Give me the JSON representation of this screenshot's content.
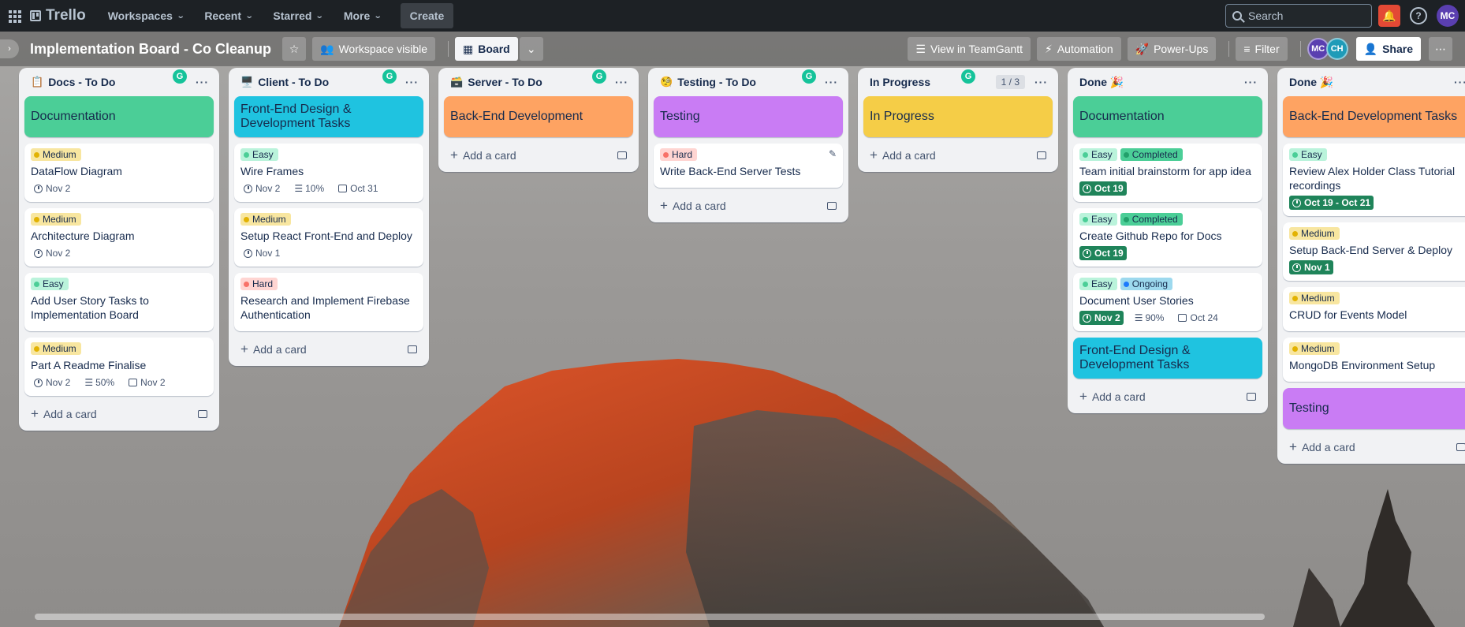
{
  "nav": {
    "logo": "Trello",
    "menus": [
      "Workspaces",
      "Recent",
      "Starred",
      "More"
    ],
    "create": "Create",
    "search_placeholder": "Search",
    "avatar": "MC"
  },
  "board": {
    "title": "Implementation Board - Co Cleanup",
    "visibility": "Workspace visible",
    "view": "Board",
    "buttons": {
      "teamgantt": "View in TeamGantt",
      "automation": "Automation",
      "powerups": "Power-Ups",
      "filter": "Filter",
      "share": "Share"
    },
    "members": [
      "MC",
      "CH"
    ]
  },
  "lists": [
    {
      "emoji": "📋",
      "title": "Docs - To Do",
      "cards": [
        {
          "cover": true,
          "color": "#4bce97",
          "title": "Documentation"
        },
        {
          "labels": [
            {
              "text": "Medium",
              "dot": "#e2b203",
              "bg": "#f8e6a0"
            }
          ],
          "title": "DataFlow Diagram",
          "badges": [
            {
              "type": "date",
              "text": "Nov 2"
            }
          ]
        },
        {
          "labels": [
            {
              "text": "Medium",
              "dot": "#e2b203",
              "bg": "#f8e6a0"
            }
          ],
          "title": "Architecture Diagram",
          "badges": [
            {
              "type": "date",
              "text": "Nov 2"
            }
          ]
        },
        {
          "labels": [
            {
              "text": "Easy",
              "dot": "#4bce97",
              "bg": "#baf3db"
            }
          ],
          "title": "Add User Story Tasks to Implementation Board",
          "badges": []
        },
        {
          "labels": [
            {
              "text": "Medium",
              "dot": "#e2b203",
              "bg": "#f8e6a0"
            }
          ],
          "title": "Part A Readme Finalise",
          "badges": [
            {
              "type": "date",
              "text": "Nov 2"
            },
            {
              "type": "checklist",
              "text": "50%"
            },
            {
              "type": "cal",
              "text": "Nov 2"
            }
          ]
        }
      ],
      "add": "Add a card"
    },
    {
      "emoji": "🖥️",
      "title": "Client - To Do",
      "cards": [
        {
          "cover": true,
          "color": "#1fc3e0",
          "title": "Front-End Design & Development Tasks"
        },
        {
          "labels": [
            {
              "text": "Easy",
              "dot": "#4bce97",
              "bg": "#baf3db"
            }
          ],
          "title": "Wire Frames",
          "badges": [
            {
              "type": "date",
              "text": "Nov 2"
            },
            {
              "type": "checklist",
              "text": "10%"
            },
            {
              "type": "cal",
              "text": "Oct 31"
            }
          ]
        },
        {
          "labels": [
            {
              "text": "Medium",
              "dot": "#e2b203",
              "bg": "#f8e6a0"
            }
          ],
          "title": "Setup React Front-End and Deploy",
          "badges": [
            {
              "type": "date",
              "text": "Nov 1"
            }
          ]
        },
        {
          "labels": [
            {
              "text": "Hard",
              "dot": "#f87168",
              "bg": "#ffd5d2"
            }
          ],
          "title": "Research and Implement Firebase Authentication",
          "badges": []
        }
      ],
      "add": "Add a card"
    },
    {
      "emoji": "🗃️",
      "title": "Server - To Do",
      "cards": [
        {
          "cover": true,
          "color": "#fea362",
          "title": "Back-End Development"
        }
      ],
      "add": "Add a card"
    },
    {
      "emoji": "🧐",
      "title": "Testing - To Do",
      "cards": [
        {
          "cover": true,
          "color": "#c97cf4",
          "title": "Testing"
        },
        {
          "labels": [
            {
              "text": "Hard",
              "dot": "#f87168",
              "bg": "#ffd5d2"
            }
          ],
          "title": "Write Back-End Server Tests",
          "badges": [],
          "edit": true
        }
      ],
      "add": "Add a card"
    },
    {
      "emoji": "",
      "title": "In Progress",
      "count": "1 / 3",
      "cards": [
        {
          "cover": true,
          "color": "#f5cd47",
          "title": "In Progress"
        }
      ],
      "add": "Add a card"
    },
    {
      "emoji": "",
      "title": "Done 🎉",
      "cards": [
        {
          "cover": true,
          "color": "#4bce97",
          "title": "Documentation"
        },
        {
          "labels": [
            {
              "text": "Easy",
              "dot": "#4bce97",
              "bg": "#baf3db"
            },
            {
              "text": "Completed",
              "dot": "#22a06b",
              "bg": "#4bce97"
            }
          ],
          "title": "Team initial brainstorm for app idea",
          "badges": [
            {
              "type": "date-green",
              "text": "Oct 19"
            }
          ]
        },
        {
          "labels": [
            {
              "text": "Easy",
              "dot": "#4bce97",
              "bg": "#baf3db"
            },
            {
              "text": "Completed",
              "dot": "#22a06b",
              "bg": "#4bce97"
            }
          ],
          "title": "Create Github Repo for Docs",
          "badges": [
            {
              "type": "date-green",
              "text": "Oct 19"
            }
          ]
        },
        {
          "labels": [
            {
              "text": "Easy",
              "dot": "#4bce97",
              "bg": "#baf3db"
            },
            {
              "text": "Ongoing",
              "dot": "#1d7afc",
              "bg": "#9dd9ee"
            }
          ],
          "title": "Document User Stories",
          "badges": [
            {
              "type": "date-green",
              "text": "Nov 2"
            },
            {
              "type": "checklist",
              "text": "90%"
            },
            {
              "type": "cal",
              "text": "Oct 24"
            }
          ]
        },
        {
          "cover": true,
          "color": "#1fc3e0",
          "title": "Front-End Design & Development Tasks"
        }
      ],
      "add": "Add a card"
    },
    {
      "emoji": "",
      "title": "Done 🎉",
      "cards": [
        {
          "cover": true,
          "color": "#fea362",
          "title": "Back-End Development Tasks"
        },
        {
          "labels": [
            {
              "text": "Easy",
              "dot": "#4bce97",
              "bg": "#baf3db"
            }
          ],
          "title": "Review Alex Holder Class Tutorial recordings",
          "badges": [
            {
              "type": "date-green",
              "text": "Oct 19 - Oct 21"
            }
          ]
        },
        {
          "labels": [
            {
              "text": "Medium",
              "dot": "#e2b203",
              "bg": "#f8e6a0"
            }
          ],
          "title": "Setup Back-End Server & Deploy",
          "badges": [
            {
              "type": "date-green",
              "text": "Nov 1"
            }
          ]
        },
        {
          "labels": [
            {
              "text": "Medium",
              "dot": "#e2b203",
              "bg": "#f8e6a0"
            }
          ],
          "title": "CRUD for Events Model",
          "badges": []
        },
        {
          "labels": [
            {
              "text": "Medium",
              "dot": "#e2b203",
              "bg": "#f8e6a0"
            }
          ],
          "title": "MongoDB Environment Setup",
          "badges": []
        },
        {
          "cover": true,
          "color": "#c97cf4",
          "title": "Testing"
        }
      ],
      "add": "Add a card"
    }
  ]
}
